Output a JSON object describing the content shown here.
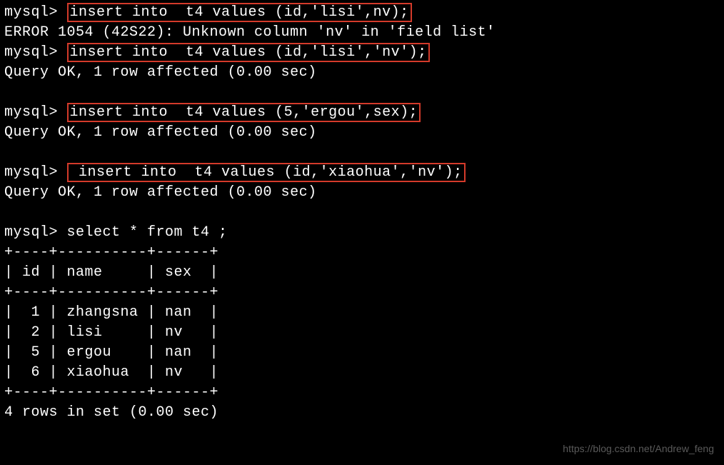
{
  "terminal": {
    "prompt": "mysql> ",
    "lines": [
      {
        "prefix": "mysql> ",
        "boxed": "insert into  t4 values (id,'lisi',nv);",
        "hasBox": true
      },
      {
        "text": "ERROR 1054 (42S22): Unknown column 'nv' in 'field list'"
      },
      {
        "prefix": "mysql> ",
        "boxed": "insert into  t4 values (id,'lisi','nv');",
        "hasBox": true
      },
      {
        "text": "Query OK, 1 row affected (0.00 sec)"
      },
      {
        "text": ""
      },
      {
        "prefix": "mysql> ",
        "boxed": "insert into  t4 values (5,'ergou',sex);",
        "hasBox": true
      },
      {
        "text": "Query OK, 1 row affected (0.00 sec)"
      },
      {
        "text": ""
      },
      {
        "prefix": "mysql> ",
        "boxed": " insert into  t4 values (id,'xiaohua','nv');",
        "hasBox": true
      },
      {
        "text": "Query OK, 1 row affected (0.00 sec)"
      },
      {
        "text": ""
      },
      {
        "text": "mysql> select * from t4 ;"
      },
      {
        "text": "+----+----------+------+"
      },
      {
        "text": "| id | name     | sex  |"
      },
      {
        "text": "+----+----------+------+"
      },
      {
        "text": "|  1 | zhangsna | nan  |"
      },
      {
        "text": "|  2 | lisi     | nv   |"
      },
      {
        "text": "|  5 | ergou    | nan  |"
      },
      {
        "text": "|  6 | xiaohua  | nv   |"
      },
      {
        "text": "+----+----------+------+"
      },
      {
        "text": "4 rows in set (0.00 sec)"
      }
    ]
  },
  "chart_data": {
    "type": "table",
    "title": "t4",
    "columns": [
      "id",
      "name",
      "sex"
    ],
    "rows": [
      [
        1,
        "zhangsna",
        "nan"
      ],
      [
        2,
        "lisi",
        "nv"
      ],
      [
        5,
        "ergou",
        "nan"
      ],
      [
        6,
        "xiaohua",
        "nv"
      ]
    ]
  },
  "watermark": "https://blog.csdn.net/Andrew_feng"
}
